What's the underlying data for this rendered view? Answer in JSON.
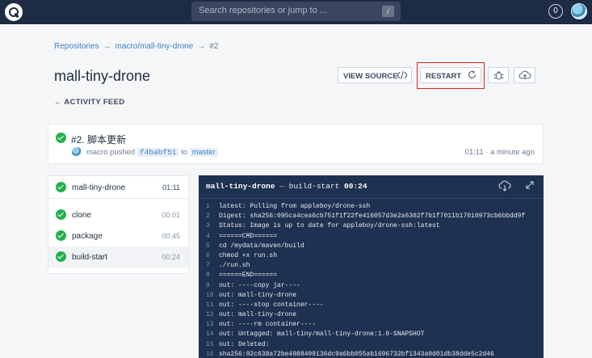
{
  "search": {
    "placeholder": "Search repositories or jump to ...",
    "shortcut": "/"
  },
  "notifications": {
    "count": "0"
  },
  "breadcrumb": {
    "root": "Repositories",
    "repo": "macro/mall-tiny-drone",
    "build": "#2",
    "sep": "→"
  },
  "page_title": "mall-tiny-drone",
  "activity_feed": "← ACTIVITY FEED",
  "buttons": {
    "view_source": "VIEW SOURCE",
    "restart": "RESTART"
  },
  "icons": {
    "logo": "drone-logo-icon",
    "code": "code-brackets-icon",
    "restart": "refresh-icon",
    "debug": "bug-icon",
    "promote": "cloud-upload-icon",
    "download": "cloud-download-icon",
    "expand": "expand-icon",
    "status": "check-circle-icon"
  },
  "colors": {
    "success": "#22b14c",
    "nav": "#1e2b45",
    "log_bg": "#1f3150",
    "link": "#3f7fc5",
    "highlight": "#d9261c"
  },
  "build": {
    "title": "#2. 脚本更新",
    "author": "macro",
    "pushed": "pushed",
    "commit": "f4babf51",
    "to": "to",
    "branch": "master",
    "duration": "01:11",
    "time_sep": "·",
    "ago": "a minute ago"
  },
  "stages": {
    "pipeline": {
      "name": "mall-tiny-drone",
      "time": "01:11"
    },
    "steps": [
      {
        "name": "clone",
        "time": "00:01"
      },
      {
        "name": "package",
        "time": "00:45"
      },
      {
        "name": "build-start",
        "time": "00:24"
      }
    ]
  },
  "log": {
    "pipeline": "mall-tiny-drone",
    "dash": "—",
    "step": "build-start",
    "duration": "00:24",
    "lines": [
      {
        "n": "1",
        "t": "latest: Pulling from appleboy/drone-ssh"
      },
      {
        "n": "2",
        "t": "Digest: sha256:095ca4cea6cb751f1f22fe416057d3e2a6302f7b1f7011b17010973cb6bbdd9f"
      },
      {
        "n": "3",
        "t": "Status: Image is up to date for appleboy/drone-ssh:latest"
      },
      {
        "n": "4",
        "t": "======CMD======"
      },
      {
        "n": "5",
        "t": "cd /mydata/maven/build"
      },
      {
        "n": "6",
        "t": "chmod +x run.sh"
      },
      {
        "n": "7",
        "t": "./run.sh"
      },
      {
        "n": "8",
        "t": "======END======"
      },
      {
        "n": "9",
        "t": "out: ----copy jar----"
      },
      {
        "n": "10",
        "t": "out: mall-tiny-drone"
      },
      {
        "n": "11",
        "t": "out: ----stop container----"
      },
      {
        "n": "12",
        "t": "out: mall-tiny-drone"
      },
      {
        "n": "13",
        "t": "out: ----rm container----"
      },
      {
        "n": "14",
        "t": "out: Untagged: mall-tiny/mall-tiny-drone:1.0-SNAPSHOT"
      },
      {
        "n": "15",
        "t": "out: Deleted:"
      },
      {
        "n": "16",
        "t": "sha256:92c638a72be4988409136dc9a6bb055ab1696732bf1343a0d01db38dde5c2d46"
      }
    ]
  }
}
